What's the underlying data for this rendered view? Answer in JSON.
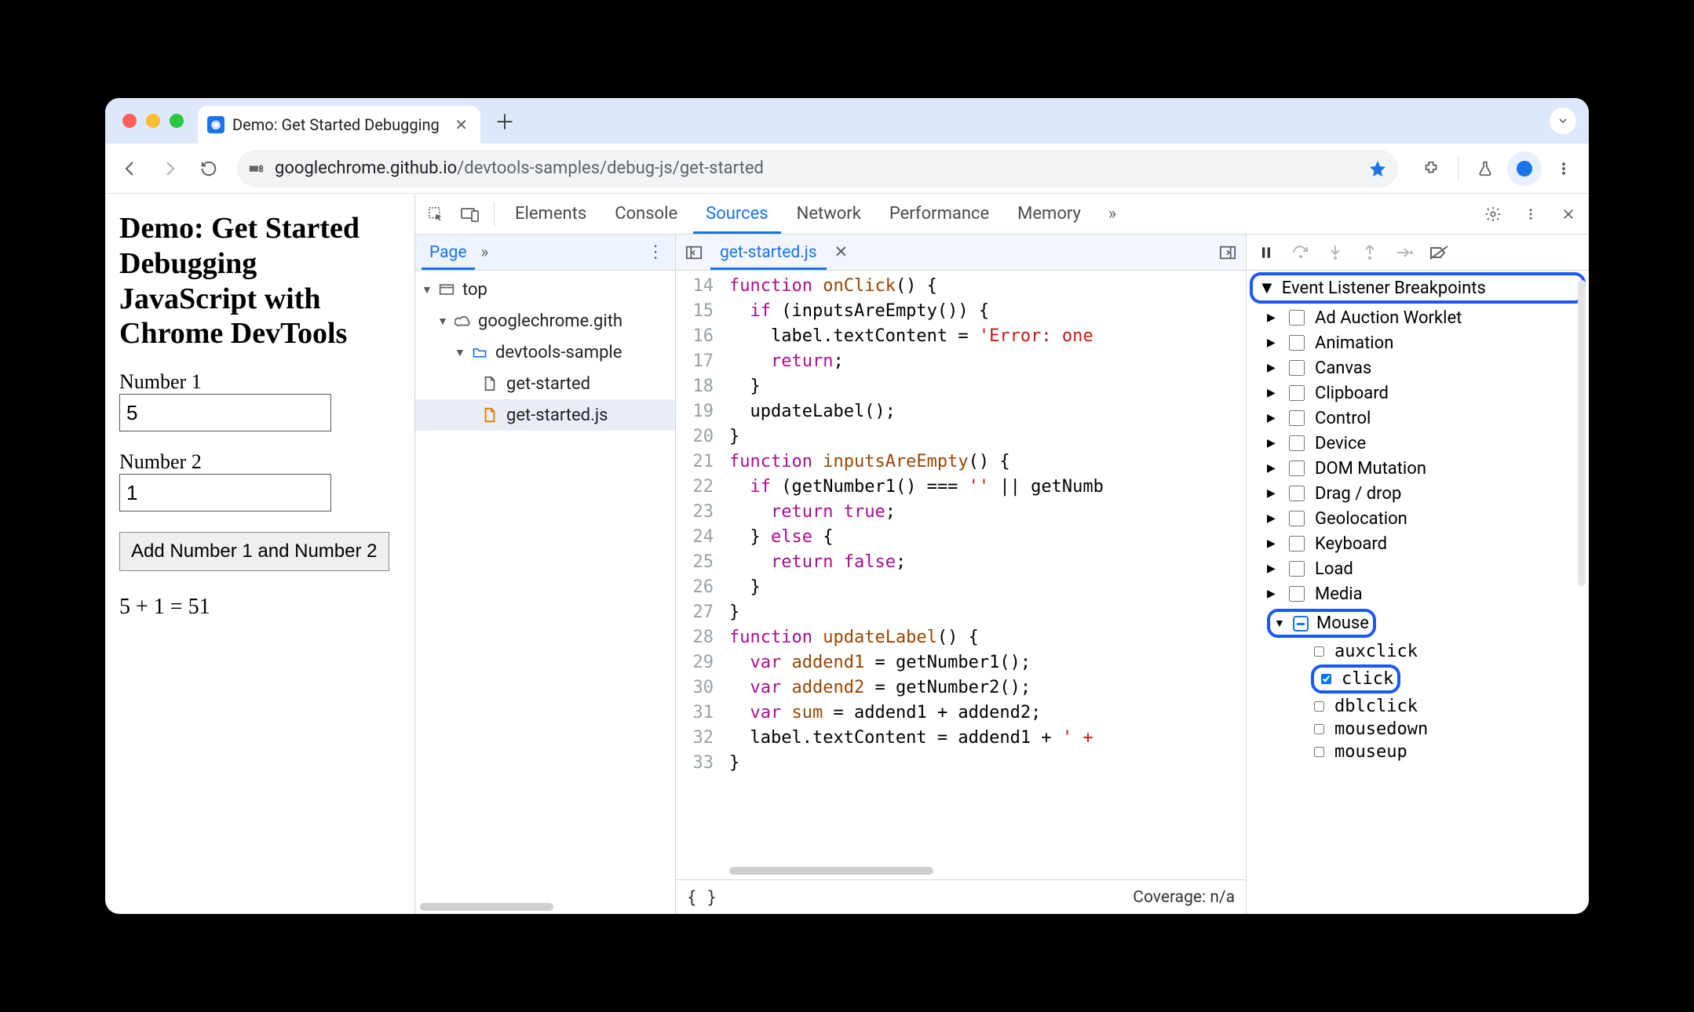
{
  "browser": {
    "tab_title": "Demo: Get Started Debugging",
    "url_host": "googlechrome.github.io",
    "url_path": "/devtools-samples/debug-js/get-started"
  },
  "page": {
    "heading": "Demo: Get Started Debugging JavaScript with Chrome DevTools",
    "label1": "Number 1",
    "value1": "5",
    "label2": "Number 2",
    "value2": "1",
    "button": "Add Number 1 and Number 2",
    "result": "5 + 1 = 51"
  },
  "devtools": {
    "tabs": [
      "Elements",
      "Console",
      "Sources",
      "Network",
      "Performance",
      "Memory"
    ],
    "active_tab": "Sources",
    "navigator": {
      "tab": "Page",
      "tree": {
        "top": "top",
        "domain": "googlechrome.gith",
        "folder": "devtools-sample",
        "files": [
          "get-started",
          "get-started.js"
        ],
        "selected": "get-started.js"
      }
    },
    "editor": {
      "filename": "get-started.js",
      "first_line": 14,
      "lines": [
        {
          "n": 14,
          "t": "function onClick() {",
          "h": [
            [
              "kw",
              "function"
            ],
            [
              "txt",
              " "
            ],
            [
              "fn",
              "onClick"
            ],
            [
              "txt",
              "() {"
            ]
          ]
        },
        {
          "n": 15,
          "t": "  if (inputsAreEmpty()) {",
          "h": [
            [
              "txt",
              "  "
            ],
            [
              "kw",
              "if"
            ],
            [
              "txt",
              " (inputsAreEmpty()) {"
            ]
          ]
        },
        {
          "n": 16,
          "t": "    label.textContent = 'Error: one",
          "h": [
            [
              "txt",
              "    label.textContent = "
            ],
            [
              "str",
              "'Error: one"
            ]
          ]
        },
        {
          "n": 17,
          "t": "    return;",
          "h": [
            [
              "txt",
              "    "
            ],
            [
              "kw",
              "return"
            ],
            [
              "txt",
              ";"
            ]
          ]
        },
        {
          "n": 18,
          "t": "  }",
          "h": [
            [
              "txt",
              "  }"
            ]
          ]
        },
        {
          "n": 19,
          "t": "  updateLabel();",
          "h": [
            [
              "txt",
              "  updateLabel();"
            ]
          ]
        },
        {
          "n": 20,
          "t": "}",
          "h": [
            [
              "txt",
              "}"
            ]
          ]
        },
        {
          "n": 21,
          "t": "function inputsAreEmpty() {",
          "h": [
            [
              "kw",
              "function"
            ],
            [
              "txt",
              " "
            ],
            [
              "fn",
              "inputsAreEmpty"
            ],
            [
              "txt",
              "() {"
            ]
          ]
        },
        {
          "n": 22,
          "t": "  if (getNumber1() === '' || getNumb",
          "h": [
            [
              "txt",
              "  "
            ],
            [
              "kw",
              "if"
            ],
            [
              "txt",
              " (getNumber1() === "
            ],
            [
              "str",
              "''"
            ],
            [
              "txt",
              " || getNumb"
            ]
          ]
        },
        {
          "n": 23,
          "t": "    return true;",
          "h": [
            [
              "txt",
              "    "
            ],
            [
              "kw",
              "return"
            ],
            [
              "txt",
              " "
            ],
            [
              "bool",
              "true"
            ],
            [
              "txt",
              ";"
            ]
          ]
        },
        {
          "n": 24,
          "t": "  } else {",
          "h": [
            [
              "txt",
              "  } "
            ],
            [
              "kw",
              "else"
            ],
            [
              "txt",
              " {"
            ]
          ]
        },
        {
          "n": 25,
          "t": "    return false;",
          "h": [
            [
              "txt",
              "    "
            ],
            [
              "kw",
              "return"
            ],
            [
              "txt",
              " "
            ],
            [
              "bool",
              "false"
            ],
            [
              "txt",
              ";"
            ]
          ]
        },
        {
          "n": 26,
          "t": "  }",
          "h": [
            [
              "txt",
              "  }"
            ]
          ]
        },
        {
          "n": 27,
          "t": "}",
          "h": [
            [
              "txt",
              "}"
            ]
          ]
        },
        {
          "n": 28,
          "t": "function updateLabel() {",
          "h": [
            [
              "kw",
              "function"
            ],
            [
              "txt",
              " "
            ],
            [
              "fn",
              "updateLabel"
            ],
            [
              "txt",
              "() {"
            ]
          ]
        },
        {
          "n": 29,
          "t": "  var addend1 = getNumber1();",
          "h": [
            [
              "txt",
              "  "
            ],
            [
              "kw",
              "var"
            ],
            [
              "txt",
              " "
            ],
            [
              "fn",
              "addend1"
            ],
            [
              "txt",
              " = getNumber1();"
            ]
          ]
        },
        {
          "n": 30,
          "t": "  var addend2 = getNumber2();",
          "h": [
            [
              "txt",
              "  "
            ],
            [
              "kw",
              "var"
            ],
            [
              "txt",
              " "
            ],
            [
              "fn",
              "addend2"
            ],
            [
              "txt",
              " = getNumber2();"
            ]
          ]
        },
        {
          "n": 31,
          "t": "  var sum = addend1 + addend2;",
          "h": [
            [
              "txt",
              "  "
            ],
            [
              "kw",
              "var"
            ],
            [
              "txt",
              " "
            ],
            [
              "fn",
              "sum"
            ],
            [
              "txt",
              " = addend1 + addend2;"
            ]
          ]
        },
        {
          "n": 32,
          "t": "  label.textContent = addend1 + ' +",
          "h": [
            [
              "txt",
              "  label.textContent = addend1 + "
            ],
            [
              "str",
              "' +"
            ]
          ]
        },
        {
          "n": 33,
          "t": "}",
          "h": [
            [
              "txt",
              "}"
            ]
          ]
        }
      ],
      "coverage": "Coverage: n/a",
      "format_icon": "{ }"
    },
    "breakpoints": {
      "title": "Event Listener Breakpoints",
      "categories": [
        {
          "name": "Ad Auction Worklet",
          "checked": false,
          "expanded": false
        },
        {
          "name": "Animation",
          "checked": false,
          "expanded": false
        },
        {
          "name": "Canvas",
          "checked": false,
          "expanded": false
        },
        {
          "name": "Clipboard",
          "checked": false,
          "expanded": false
        },
        {
          "name": "Control",
          "checked": false,
          "expanded": false
        },
        {
          "name": "Device",
          "checked": false,
          "expanded": false
        },
        {
          "name": "DOM Mutation",
          "checked": false,
          "expanded": false
        },
        {
          "name": "Drag / drop",
          "checked": false,
          "expanded": false
        },
        {
          "name": "Geolocation",
          "checked": false,
          "expanded": false
        },
        {
          "name": "Keyboard",
          "checked": false,
          "expanded": false
        },
        {
          "name": "Load",
          "checked": false,
          "expanded": false
        },
        {
          "name": "Media",
          "checked": false,
          "expanded": false
        },
        {
          "name": "Mouse",
          "checked": "mixed",
          "expanded": true,
          "highlight": true,
          "children": [
            {
              "name": "auxclick",
              "checked": false
            },
            {
              "name": "click",
              "checked": true,
              "highlight": true
            },
            {
              "name": "dblclick",
              "checked": false
            },
            {
              "name": "mousedown",
              "checked": false
            },
            {
              "name": "mouseup",
              "checked": false
            }
          ]
        }
      ]
    }
  }
}
